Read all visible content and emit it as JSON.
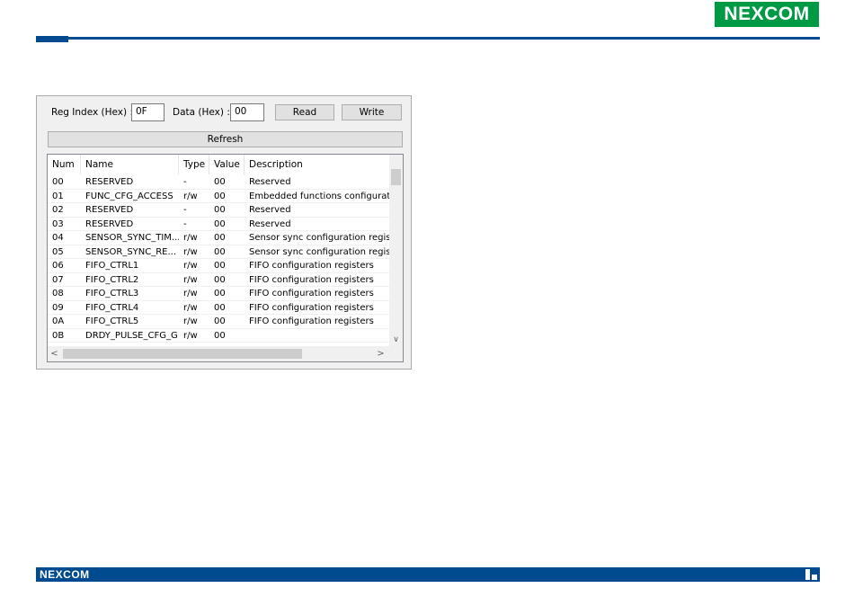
{
  "brand": {
    "logo_text": "NEXCOM",
    "primary_color": "#004a8f",
    "logo_green": "#009a44"
  },
  "controls": {
    "reg_index_label": "Reg Index (Hex) :",
    "reg_index_value": "0F",
    "data_label": "Data (Hex) :",
    "data_value": "00",
    "read_label": "Read",
    "write_label": "Write",
    "refresh_label": "Refresh"
  },
  "table": {
    "headers": {
      "num": "Num",
      "name": "Name",
      "type": "Type",
      "value": "Value",
      "description": "Description"
    },
    "rows": [
      {
        "num": "00",
        "name": "RESERVED",
        "type": "-",
        "value": "00",
        "description": "Reserved"
      },
      {
        "num": "01",
        "name": "FUNC_CFG_ACCESS",
        "type": "r/w",
        "value": "00",
        "description": "Embedded functions configuration r"
      },
      {
        "num": "02",
        "name": "RESERVED",
        "type": "-",
        "value": "00",
        "description": "Reserved"
      },
      {
        "num": "03",
        "name": "RESERVED",
        "type": "-",
        "value": "00",
        "description": "Reserved"
      },
      {
        "num": "04",
        "name": "SENSOR_SYNC_TIM...",
        "type": "r/w",
        "value": "00",
        "description": "Sensor sync configuration register"
      },
      {
        "num": "05",
        "name": "SENSOR_SYNC_RE...",
        "type": "r/w",
        "value": "00",
        "description": "Sensor sync configuration register"
      },
      {
        "num": "06",
        "name": "FIFO_CTRL1",
        "type": "r/w",
        "value": "00",
        "description": "FIFO configuration registers"
      },
      {
        "num": "07",
        "name": "FIFO_CTRL2",
        "type": "r/w",
        "value": "00",
        "description": "FIFO configuration registers"
      },
      {
        "num": "08",
        "name": "FIFO_CTRL3",
        "type": "r/w",
        "value": "00",
        "description": "FIFO configuration registers"
      },
      {
        "num": "09",
        "name": "FIFO_CTRL4",
        "type": "r/w",
        "value": "00",
        "description": "FIFO configuration registers"
      },
      {
        "num": "0A",
        "name": "FIFO_CTRL5",
        "type": "r/w",
        "value": "00",
        "description": "FIFO configuration registers"
      },
      {
        "num": "0B",
        "name": "DRDY_PULSE_CFG_G",
        "type": "r/w",
        "value": "00",
        "description": ""
      }
    ]
  }
}
